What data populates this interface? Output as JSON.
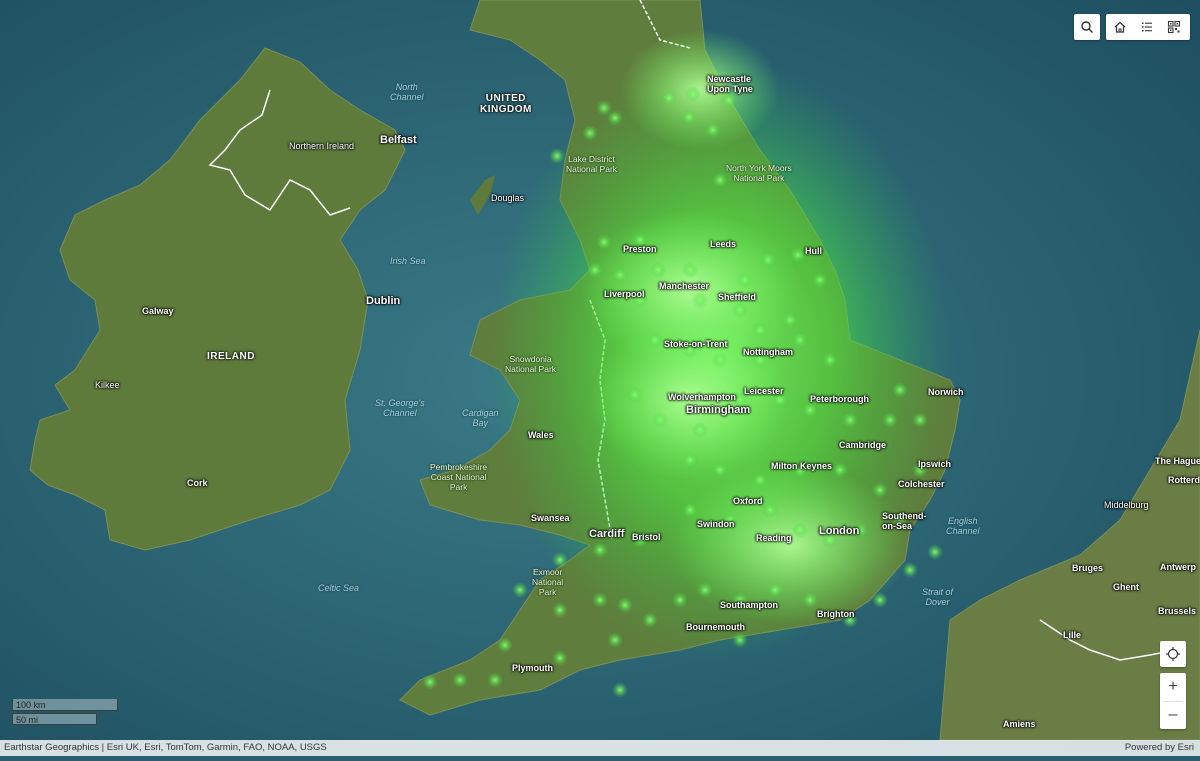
{
  "map": {
    "countries": [
      {
        "id": "uk",
        "label": "UNITED\nKINGDOM"
      },
      {
        "id": "ireland",
        "label": "IRELAND"
      }
    ],
    "water_labels": [
      {
        "id": "north-channel",
        "label": "North\nChannel"
      },
      {
        "id": "irish-sea",
        "label": "Irish Sea"
      },
      {
        "id": "st-georges-channel",
        "label": "St. George's\nChannel"
      },
      {
        "id": "cardigan-bay",
        "label": "Cardigan\nBay"
      },
      {
        "id": "celtic-sea",
        "label": "Celtic Sea"
      },
      {
        "id": "english-channel",
        "label": "English\nChannel"
      },
      {
        "id": "strait-of-dover",
        "label": "Strait of\nDover"
      }
    ],
    "parks": [
      {
        "id": "lake-district",
        "label": "Lake District\nNational Park"
      },
      {
        "id": "north-york-moors",
        "label": "North York Moors\nNational Park"
      },
      {
        "id": "snowdonia",
        "label": "Snowdonia\nNational Park"
      },
      {
        "id": "pembrokeshire",
        "label": "Pembrokeshire\nCoast National\nPark"
      },
      {
        "id": "exmoor",
        "label": "Exmoor\nNational\nPark"
      }
    ],
    "cities": [
      {
        "id": "newcastle",
        "label": "Newcastle\nUpon Tyne"
      },
      {
        "id": "belfast",
        "label": "Belfast"
      },
      {
        "id": "northern-ireland",
        "label": "Northern Ireland"
      },
      {
        "id": "douglas",
        "label": "Douglas"
      },
      {
        "id": "preston",
        "label": "Preston"
      },
      {
        "id": "leeds",
        "label": "Leeds"
      },
      {
        "id": "hull",
        "label": "Hull"
      },
      {
        "id": "liverpool",
        "label": "Liverpool"
      },
      {
        "id": "manchester",
        "label": "Manchester"
      },
      {
        "id": "sheffield",
        "label": "Sheffield"
      },
      {
        "id": "dublin",
        "label": "Dublin"
      },
      {
        "id": "galway",
        "label": "Galway"
      },
      {
        "id": "stoke",
        "label": "Stoke-on-Trent"
      },
      {
        "id": "nottingham",
        "label": "Nottingham"
      },
      {
        "id": "norwich",
        "label": "Norwich"
      },
      {
        "id": "kilkee",
        "label": "Kilkee"
      },
      {
        "id": "wolverhampton",
        "label": "Wolverhampton"
      },
      {
        "id": "leicester",
        "label": "Leicester"
      },
      {
        "id": "peterborough",
        "label": "Peterborough"
      },
      {
        "id": "birmingham",
        "label": "Birmingham"
      },
      {
        "id": "cambridge",
        "label": "Cambridge"
      },
      {
        "id": "wales",
        "label": "Wales"
      },
      {
        "id": "ipswich",
        "label": "Ipswich"
      },
      {
        "id": "milton-keynes",
        "label": "Milton Keynes"
      },
      {
        "id": "cork",
        "label": "Cork"
      },
      {
        "id": "colchester",
        "label": "Colchester"
      },
      {
        "id": "oxford",
        "label": "Oxford"
      },
      {
        "id": "swansea",
        "label": "Swansea"
      },
      {
        "id": "swindon",
        "label": "Swindon"
      },
      {
        "id": "cardiff",
        "label": "Cardiff"
      },
      {
        "id": "bristol",
        "label": "Bristol"
      },
      {
        "id": "london",
        "label": "London"
      },
      {
        "id": "southend",
        "label": "Southend-\non-Sea"
      },
      {
        "id": "reading",
        "label": "Reading"
      },
      {
        "id": "southampton",
        "label": "Southampton"
      },
      {
        "id": "brighton",
        "label": "Brighton"
      },
      {
        "id": "bournemouth",
        "label": "Bournemouth"
      },
      {
        "id": "plymouth",
        "label": "Plymouth"
      },
      {
        "id": "the-hague",
        "label": "The Hague"
      },
      {
        "id": "rotterdam",
        "label": "Rotterd"
      },
      {
        "id": "middelburg",
        "label": "Middelburg"
      },
      {
        "id": "bruges",
        "label": "Bruges"
      },
      {
        "id": "ghent",
        "label": "Ghent"
      },
      {
        "id": "antwerp",
        "label": "Antwerp"
      },
      {
        "id": "brussels",
        "label": "Brussels"
      },
      {
        "id": "lille",
        "label": "Lille"
      },
      {
        "id": "amiens",
        "label": "Amiens"
      }
    ]
  },
  "toolbar": {
    "search_icon": "search-icon",
    "home_icon": "home-icon",
    "legend_icon": "list-icon",
    "qr_icon": "qr-code-icon"
  },
  "controls": {
    "locate_icon": "locate-icon",
    "zoom_in_label": "+",
    "zoom_out_label": "–"
  },
  "scale": {
    "km_label": "100 km",
    "mi_label": "50 mi"
  },
  "attribution": {
    "text": "Earthstar Geographics | Esri UK, Esri, TomTom, Garmin, FAO, NOAA, USGS",
    "powered_by": "Powered by Esri"
  },
  "colors": {
    "sea": "#2a6576",
    "land": "#5d7a3a",
    "heatmap": "#3cff3c"
  }
}
